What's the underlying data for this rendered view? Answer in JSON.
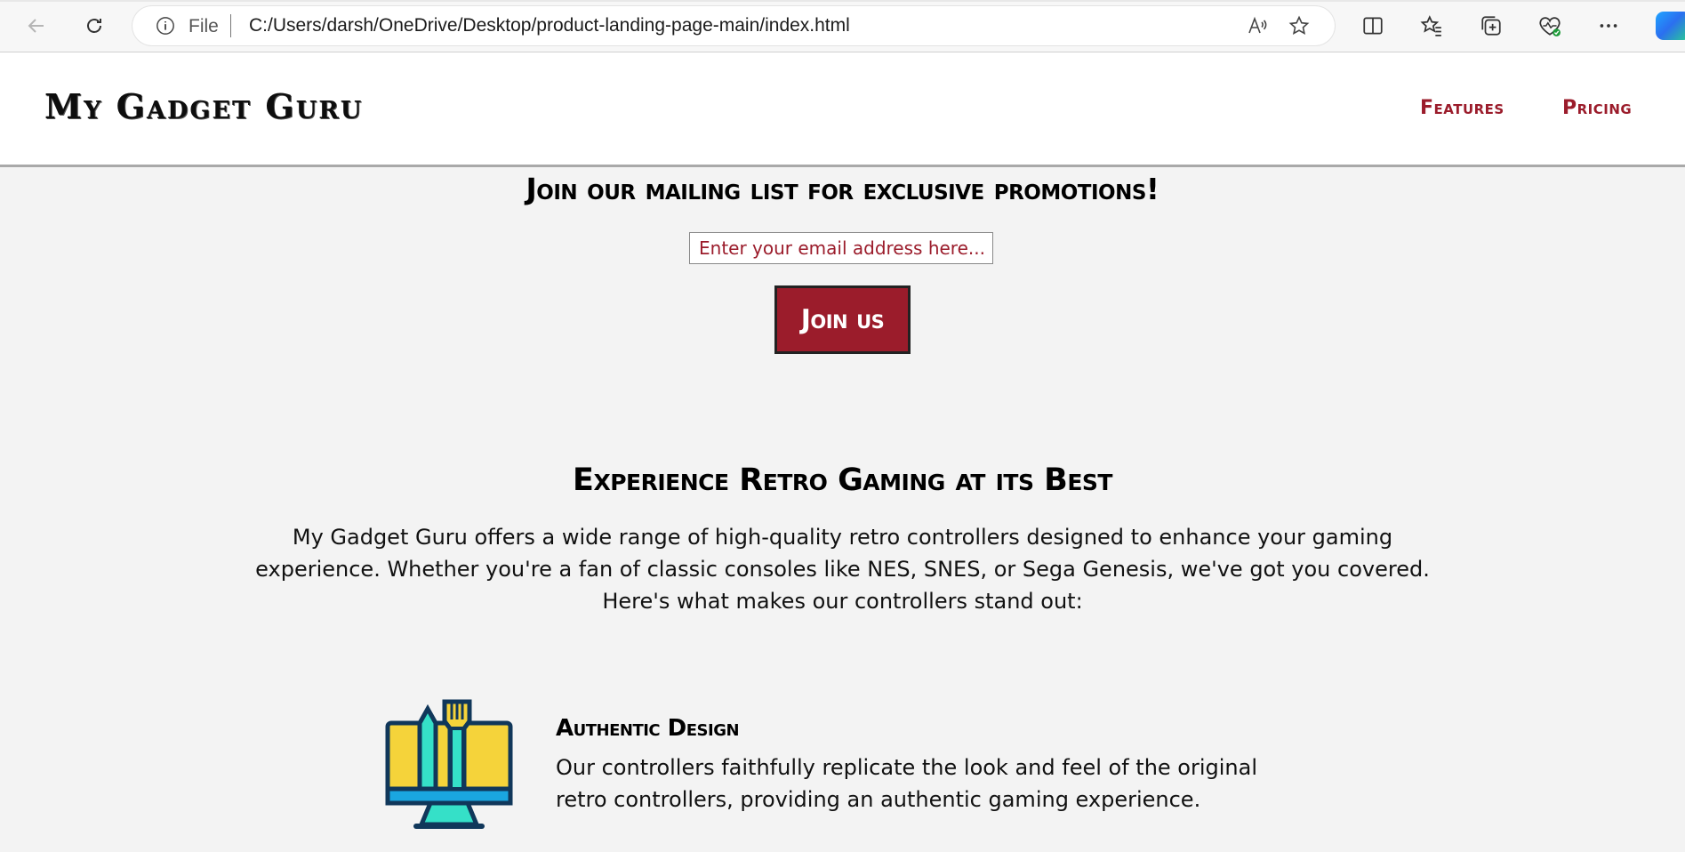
{
  "browser": {
    "file_label": "File",
    "url": "C:/Users/darsh/OneDrive/Desktop/product-landing-page-main/index.html",
    "icons": [
      "back-icon",
      "refresh-icon",
      "info-icon",
      "read-aloud-icon",
      "favorite-star-icon",
      "split-screen-icon",
      "favorites-icon",
      "collections-icon",
      "browser-essentials-icon",
      "more-icon",
      "copilot-icon"
    ]
  },
  "header": {
    "logo": "My Gadget Guru",
    "nav": [
      {
        "label": "Features"
      },
      {
        "label": "Pricing"
      }
    ]
  },
  "mailing": {
    "title": "Join our mailing list for exclusive promotions!",
    "email_placeholder": "Enter your email address here...",
    "button_label": "Join us"
  },
  "intro": {
    "title": "Experience Retro Gaming at its Best",
    "text": "My Gadget Guru offers a wide range of high-quality retro controllers designed to enhance your gaming experience. Whether you're a fan of classic consoles like NES, SNES, or Sega Genesis, we've got you covered. Here's what makes our controllers stand out:"
  },
  "features": [
    {
      "icon": "design-monitor-icon",
      "title": "Authentic Design",
      "description": "Our controllers faithfully replicate the look and feel of the original retro controllers, providing an authentic gaming experience."
    }
  ],
  "colors": {
    "accent": "#9b1c2b",
    "page_bg": "#f3f3f3",
    "header_bg": "#ffffff"
  }
}
